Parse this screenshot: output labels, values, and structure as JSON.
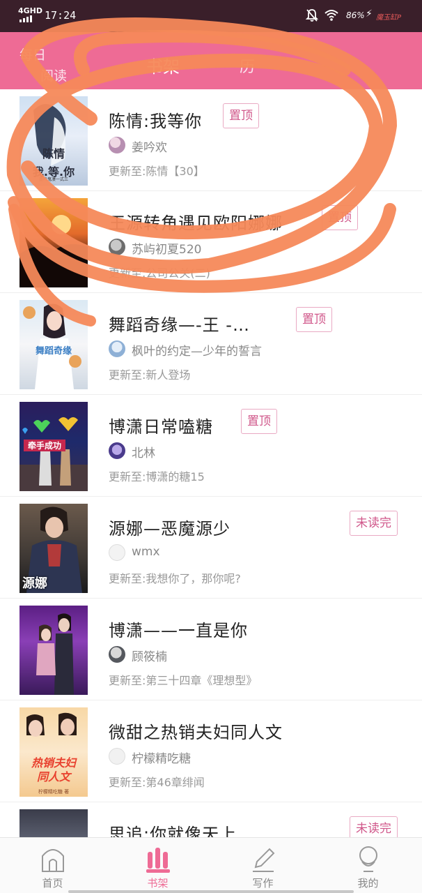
{
  "status_bar": {
    "network": "4GHD",
    "time": "17:24",
    "battery": "86%",
    "carrier": "魔玉缸P"
  },
  "header": {
    "tabs": [
      "每日",
      "书架",
      "阅读",
      "历"
    ],
    "bg_color": "#ee6b95"
  },
  "books": [
    {
      "title": "陈情:我等你",
      "author": "姜吟欢",
      "update": "更新至:陈情【30】",
      "badge": "置顶",
      "cover_text": "陈情\n我.等.你",
      "cover_subtitle": "墨吟鬼凄一式三"
    },
    {
      "title": "王源转角遇见欧阳娜娜",
      "author": "苏屿初夏520",
      "update": "更新至:公司公关(二)",
      "badge": "置顶"
    },
    {
      "title": "舞蹈奇缘—-王 -…",
      "author": "枫叶的约定—少年的誓言",
      "update": "更新至:新人登场",
      "badge": "置顶",
      "cover_text": "舞蹈奇缘"
    },
    {
      "title": "博潇日常嗑糖",
      "author": "北林",
      "update": "更新至:博潇的糖15",
      "badge": "置顶",
      "cover_text": "牵手成功"
    },
    {
      "title": "源娜—恶魔源少",
      "author": "wmx",
      "update": "更新至:我想你了，那你呢?",
      "badge": "未读完",
      "cover_text": "源娜"
    },
    {
      "title": "博潇——一直是你",
      "author": "顾筱楠",
      "update": "更新至:第三十四章《理想型》"
    },
    {
      "title": "微甜之热销夫妇同人文",
      "author": "柠檬精吃糖",
      "update": "更新至:第46章绯闻",
      "cover_text": "热销夫妇\n同人文",
      "cover_subtitle": "柠檬精吃糖 著"
    },
    {
      "title": "思追:你就像天上…",
      "badge": "未读完"
    }
  ],
  "bottom_nav": [
    {
      "label": "首页",
      "icon": "home-icon"
    },
    {
      "label": "书架",
      "icon": "bookshelf-icon",
      "active": true
    },
    {
      "label": "写作",
      "icon": "pencil-icon"
    },
    {
      "label": "我的",
      "icon": "profile-icon"
    }
  ],
  "colors": {
    "accent": "#ee6b95",
    "badge_text": "#d0578a",
    "badge_border": "#e9a9c3",
    "scribble": "#f5895a",
    "status_bar": "#3a1f2a"
  }
}
